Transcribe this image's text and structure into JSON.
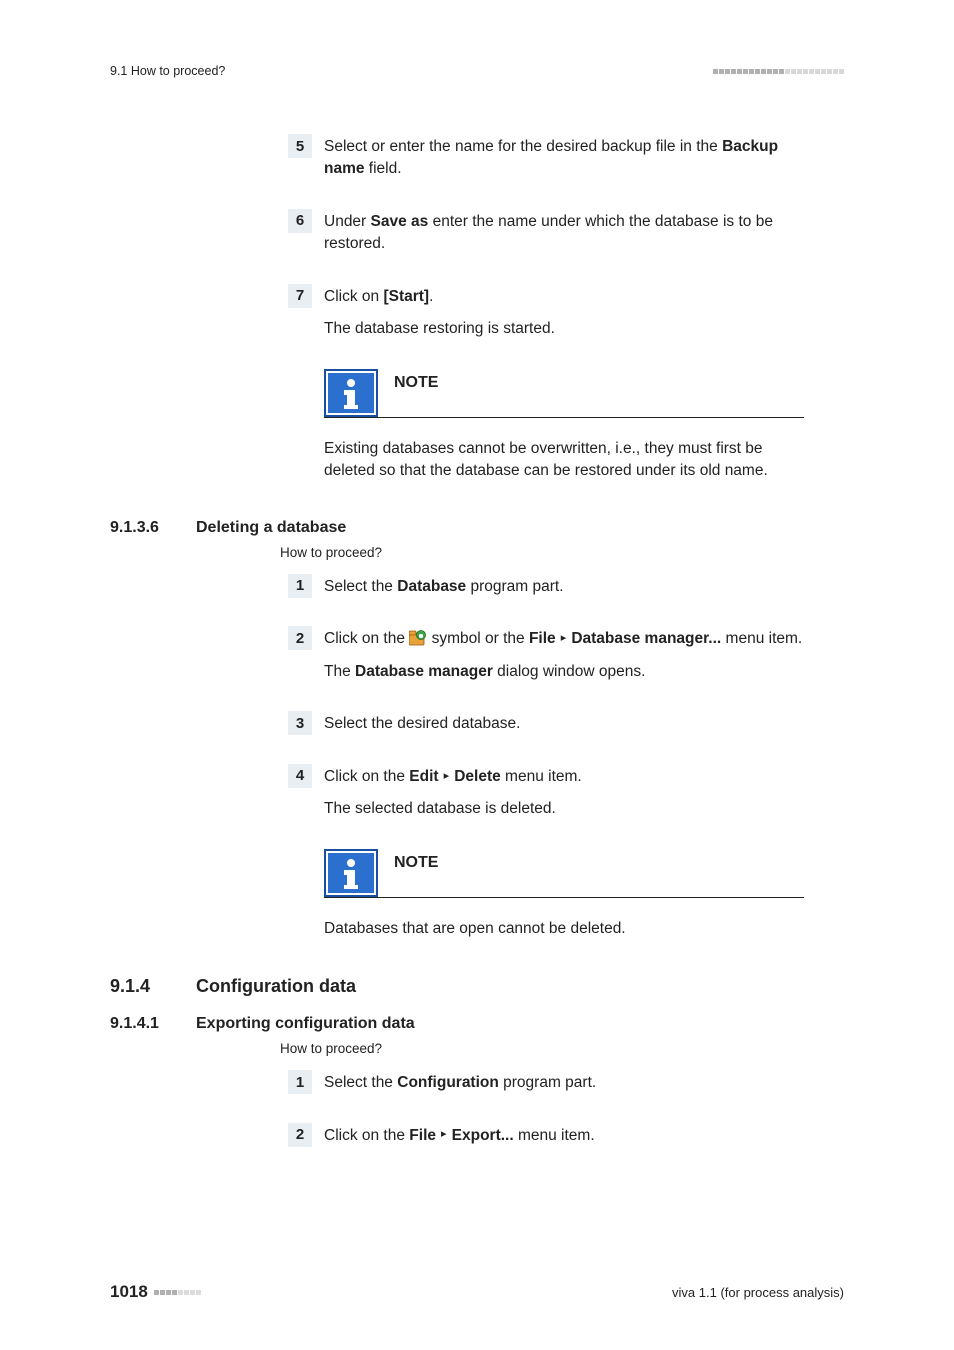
{
  "header": {
    "left": "9.1 How to proceed?"
  },
  "steps_a": {
    "s5": {
      "num": "5",
      "pre": "Select or enter the name for the desired backup file in the ",
      "b1": "Backup name",
      "post": " field."
    },
    "s6": {
      "num": "6",
      "pre": "Under ",
      "b1": "Save as",
      "post": " enter the name under which the database is to be restored."
    },
    "s7": {
      "num": "7",
      "line1_pre": "Click on ",
      "line1_b": "[Start]",
      "line1_post": ".",
      "line2": "The database restoring is started."
    }
  },
  "note1": {
    "label": "NOTE",
    "text": "Existing databases cannot be overwritten, i.e., they must first be deleted so that the database can be restored under its old name."
  },
  "sec9136": {
    "num": "9.1.3.6",
    "title": "Deleting a database",
    "sub": "How to proceed?"
  },
  "steps_b": {
    "s1": {
      "num": "1",
      "pre": "Select the ",
      "b1": "Database",
      "post": " program part."
    },
    "s2": {
      "num": "2",
      "l1a": "Click on the ",
      "l1b": " symbol or the ",
      "b1": "File",
      "b2": "Database manager...",
      "l1c": " menu item.",
      "l2a": "The ",
      "l2b": "Database manager",
      "l2c": " dialog window opens."
    },
    "s3": {
      "num": "3",
      "text": "Select the desired database."
    },
    "s4": {
      "num": "4",
      "l1a": "Click on the ",
      "b1": "Edit",
      "b2": "Delete",
      "l1b": " menu item.",
      "l2": "The selected database is deleted."
    }
  },
  "note2": {
    "label": "NOTE",
    "text": "Databases that are open cannot be deleted."
  },
  "sec914": {
    "num": "9.1.4",
    "title": "Configuration data"
  },
  "sec9141": {
    "num": "9.1.4.1",
    "title": "Exporting configuration data",
    "sub": "How to proceed?"
  },
  "steps_c": {
    "s1": {
      "num": "1",
      "pre": "Select the ",
      "b1": "Configuration",
      "post": " program part."
    },
    "s2": {
      "num": "2",
      "pre": "Click on the ",
      "b1": "File",
      "b2": "Export...",
      "post": " menu item."
    }
  },
  "footer": {
    "page": "1018",
    "right": "viva 1.1 (for process analysis)"
  }
}
